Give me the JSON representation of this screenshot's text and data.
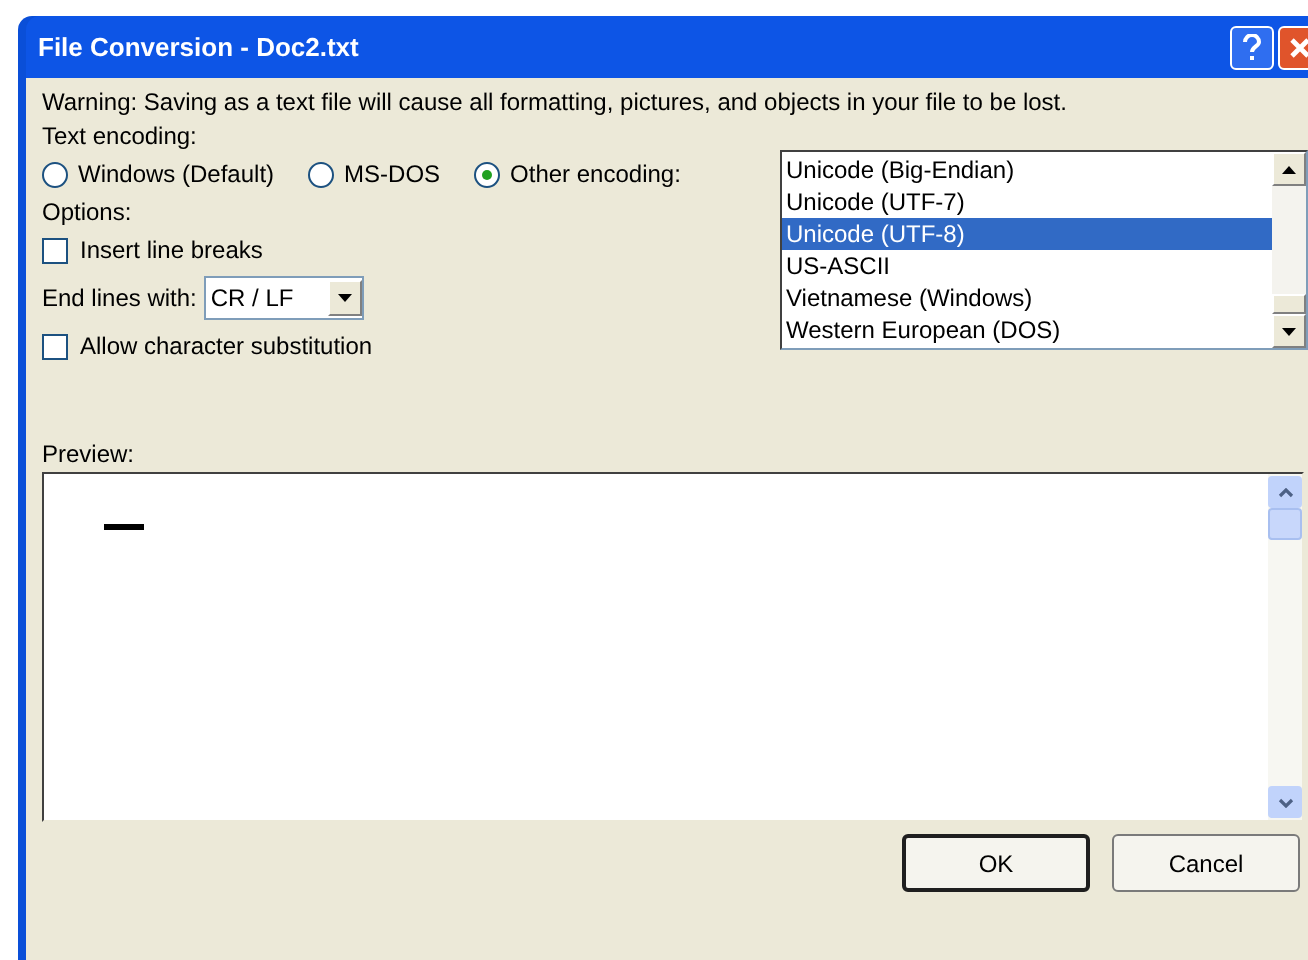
{
  "window": {
    "title": "File Conversion - Doc2.txt"
  },
  "warning": "Warning: Saving as a text file will cause all formatting, pictures, and objects in your file to be lost.",
  "text_encoding": {
    "label": "Text encoding:",
    "options": [
      {
        "label": "Windows (Default)",
        "selected": false
      },
      {
        "label": "MS-DOS",
        "selected": false
      },
      {
        "label": "Other encoding:",
        "selected": true
      }
    ]
  },
  "encodings": [
    {
      "label": "Unicode (Big-Endian)",
      "selected": false
    },
    {
      "label": "Unicode (UTF-7)",
      "selected": false
    },
    {
      "label": "Unicode (UTF-8)",
      "selected": true
    },
    {
      "label": "US-ASCII",
      "selected": false
    },
    {
      "label": "Vietnamese (Windows)",
      "selected": false
    },
    {
      "label": "Western European (DOS)",
      "selected": false
    }
  ],
  "options": {
    "label": "Options:",
    "insert_line_breaks": {
      "label": "Insert line breaks",
      "checked": false
    },
    "end_lines": {
      "label": "End lines with:",
      "value": "CR / LF"
    },
    "allow_substitution": {
      "label": "Allow character substitution",
      "checked": false
    }
  },
  "preview": {
    "label": "Preview:"
  },
  "buttons": [
    "OK",
    "Cancel"
  ]
}
